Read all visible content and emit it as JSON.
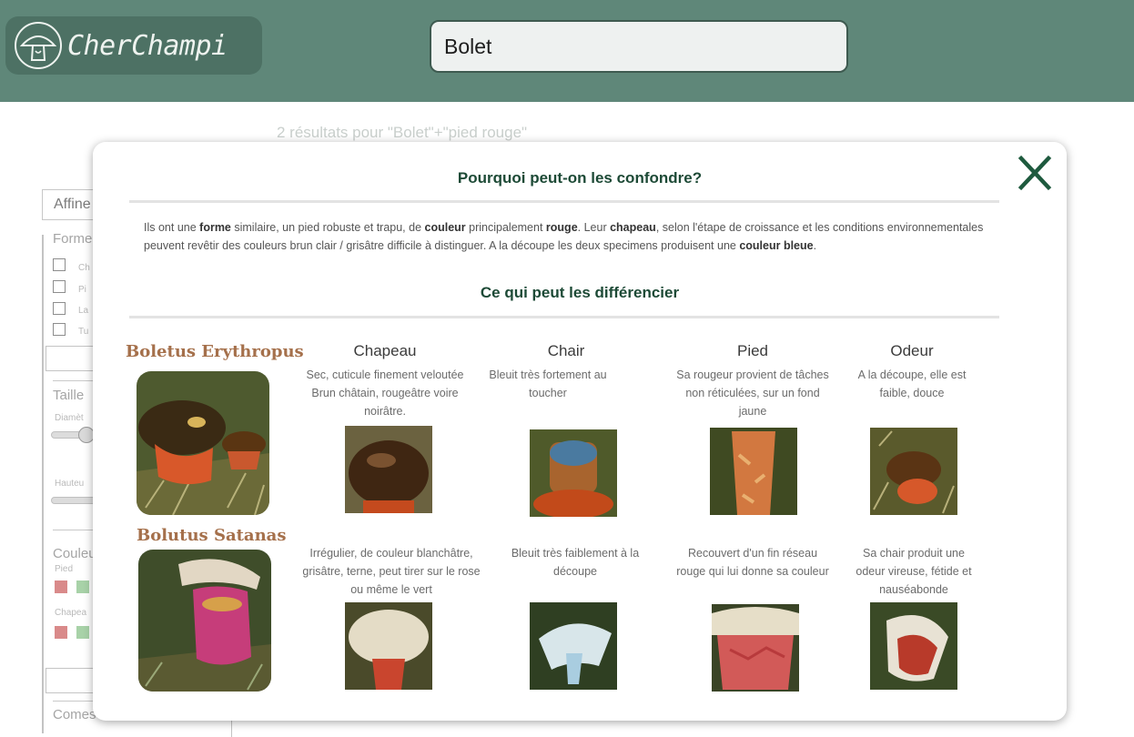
{
  "app": {
    "logo_text": "CherChampi",
    "search_value": "Bolet"
  },
  "page": {
    "results_count": "2 résultats pour \"Bolet\"+\"pied rouge\""
  },
  "filters": {
    "refine_label": "Affine",
    "forme_label": "Forme",
    "forme_options": [
      "Ch",
      "Pi",
      "La",
      "Tu"
    ],
    "taille_label": "Taille",
    "diametre_label": "Diamèt",
    "hauteur_label": "Hauteu",
    "couleur_label": "Couleu",
    "pied_label": "Pied",
    "chapeau_label": "Chapea",
    "comestible_label": "Comes"
  },
  "modal": {
    "title": "Pourquoi peut-on les confondre?",
    "intro_parts": [
      {
        "t": "Ils ont une ",
        "b": false
      },
      {
        "t": "forme",
        "b": true
      },
      {
        "t": " similaire, un pied robuste et trapu, de ",
        "b": false
      },
      {
        "t": "couleur",
        "b": true
      },
      {
        "t": " principalement ",
        "b": false
      },
      {
        "t": "rouge",
        "b": true
      },
      {
        "t": ". Leur ",
        "b": false
      },
      {
        "t": "chapeau",
        "b": true
      },
      {
        "t": ", selon l'étape de croissance et les conditions environnementales peuvent revêtir des couleurs brun clair / grisâtre difficile à distinguer. A la découpe les deux specimens produisent une ",
        "b": false
      },
      {
        "t": "couleur bleue",
        "b": true
      },
      {
        "t": ".",
        "b": false
      }
    ],
    "diff_title": "Ce qui peut les différencier",
    "columns": [
      "Chapeau",
      "Chair",
      "Pied",
      "Odeur"
    ],
    "species": [
      {
        "name": "Boletus Erythropus",
        "descriptions": [
          "Sec, cuticule finement veloutée Brun châtain, rougeâtre voire noirâtre.",
          "Bleuit très fortement au toucher",
          "Sa rougeur provient de tâches non réticulées, sur un fond jaune",
          "A la découpe, elle est faible, douce"
        ]
      },
      {
        "name": "Bolutus Satanas",
        "descriptions": [
          "Irrégulier, de couleur blanchâtre, grisâtre, terne, peut tirer sur le rose ou même le vert",
          "Bleuit très faiblement à la découpe",
          "Recouvert d'un fin réseau rouge qui lui donne sa couleur",
          "Sa chair produit une odeur vireuse, fétide et nauséabonde"
        ]
      }
    ]
  },
  "colors": {
    "header_bg": "#5f8779",
    "logo_bg": "#4d7164",
    "close_icon": "#1e5a3e",
    "species_name": "#a5704b",
    "swatch_red": "#d98a8a",
    "swatch_green": "#a8d2a8"
  },
  "icons": {
    "logo": "mushroom-logo-icon",
    "close": "close-x-icon"
  }
}
